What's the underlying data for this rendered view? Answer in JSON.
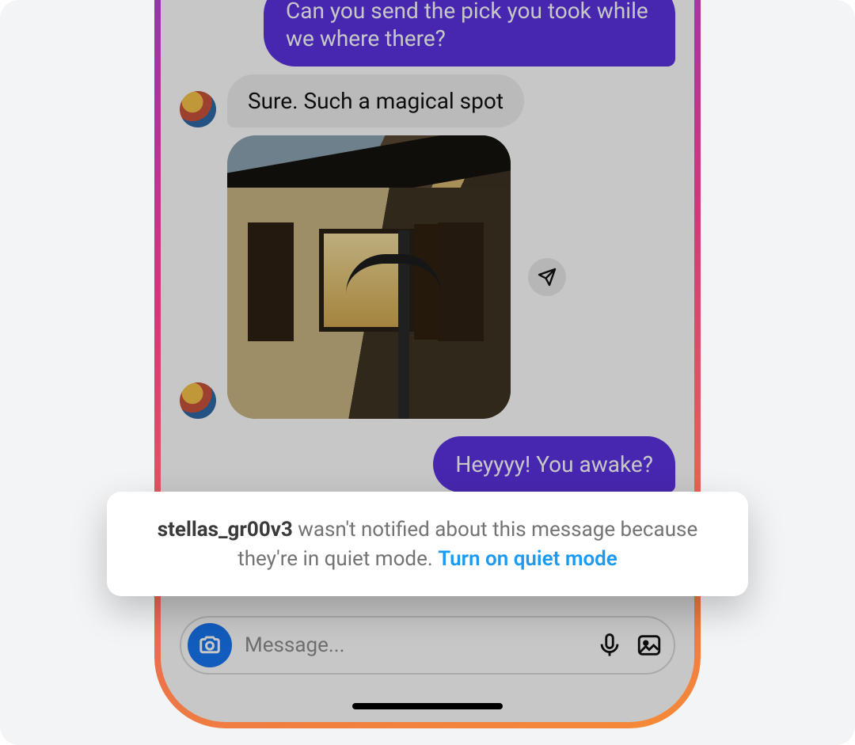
{
  "chat": {
    "sent1": "Can you send the pick you took while we where there?",
    "recv1": "Sure. Such a magical spot",
    "sent2": "Heyyyy! You awake?"
  },
  "input": {
    "placeholder": "Message..."
  },
  "toast": {
    "username": "stellas_gr00v3",
    "text_middle": " wasn't notified about this message because they're in quiet mode. ",
    "link": "Turn on quiet mode"
  },
  "icons": {
    "share": "share-icon",
    "camera": "camera-icon",
    "mic": "mic-icon",
    "gallery": "gallery-icon"
  }
}
